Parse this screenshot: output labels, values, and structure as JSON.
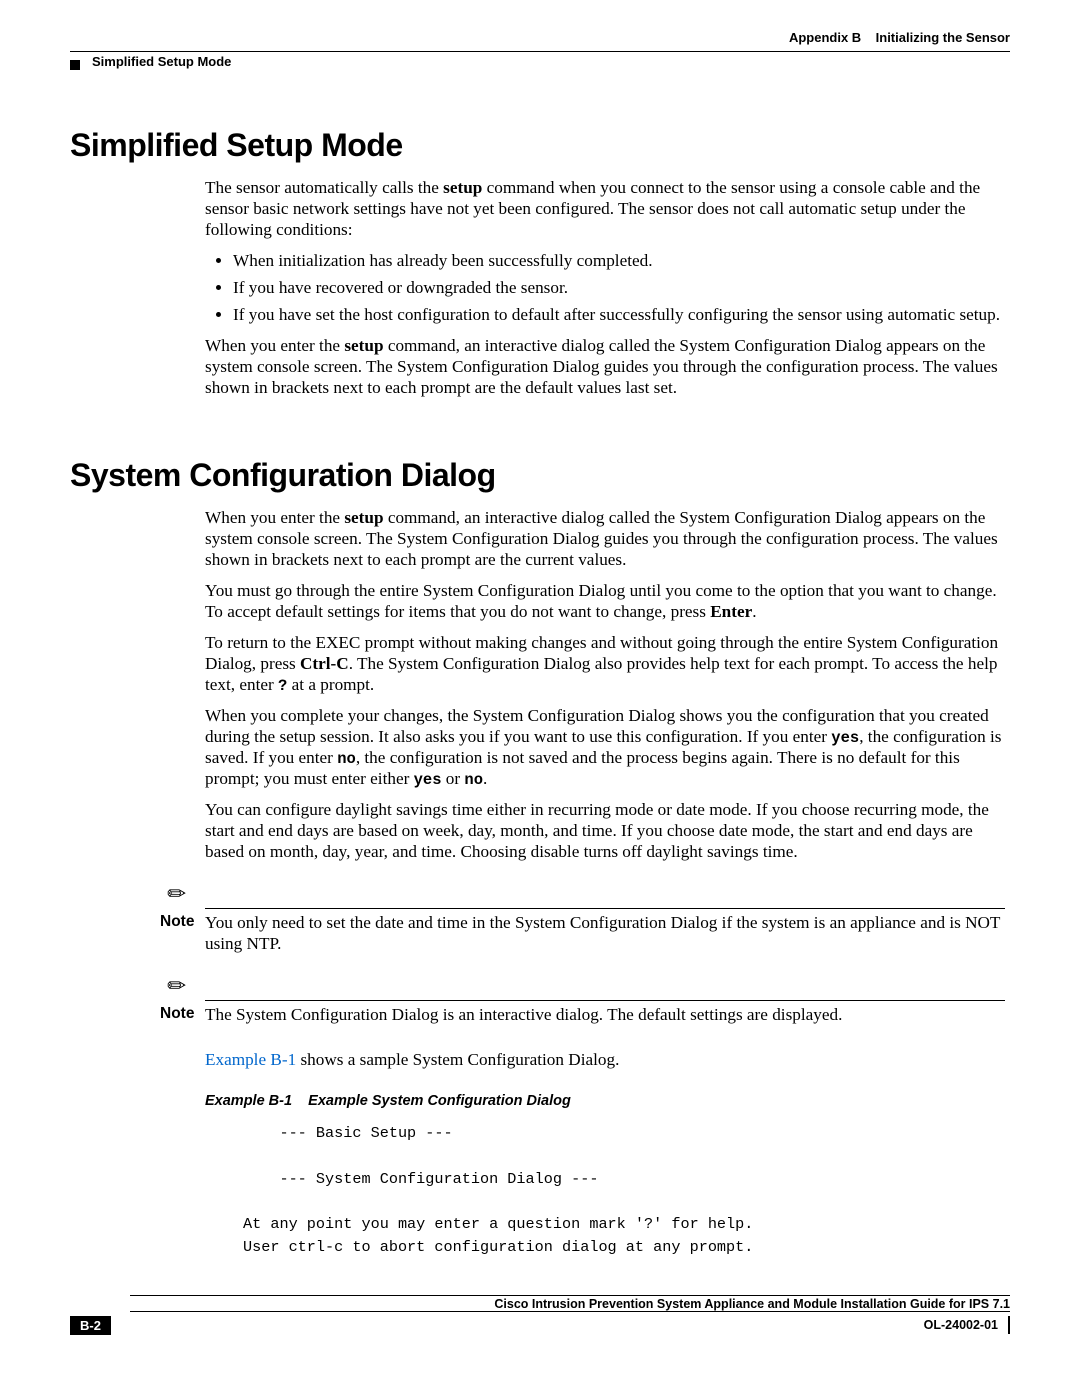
{
  "header": {
    "appendix": "Appendix B",
    "appendix_title": "Initializing the Sensor",
    "running_head": "Simplified Setup Mode"
  },
  "section1": {
    "title": "Simplified Setup Mode",
    "intro_a": "The sensor automatically calls the ",
    "intro_cmd": "setup",
    "intro_b": " command when you connect to the sensor using a console cable and the sensor basic network settings have not yet been configured. The sensor does not call automatic setup under the following conditions:",
    "bullets": [
      "When initialization has already been successfully completed.",
      "If you have recovered or downgraded the sensor.",
      "If you have set the host configuration to default after successfully configuring the sensor using automatic setup."
    ],
    "p2_a": "When you enter the ",
    "p2_cmd": "setup",
    "p2_b": " command, an interactive dialog called the System Configuration Dialog appears on the system console screen. The System Configuration Dialog guides you through the configuration process. The values shown in brackets next to each prompt are the default values last set."
  },
  "section2": {
    "title": "System Configuration Dialog",
    "p1_a": "When you enter the ",
    "p1_cmd": "setup",
    "p1_b": " command, an interactive dialog called the System Configuration Dialog appears on the system console screen. The System Configuration Dialog guides you through the configuration process. The values shown in brackets next to each prompt are the current values.",
    "p2_a": "You must go through the entire System Configuration Dialog until you come to the option that you want to change. To accept default settings for items that you do not want to change, press ",
    "p2_key": "Enter",
    "p2_b": ".",
    "p3_a": "To return to the EXEC prompt without making changes and without going through the entire System Configuration Dialog, press ",
    "p3_key": "Ctrl-C",
    "p3_b": ". The System Configuration Dialog also provides help text for each prompt. To access the help text, enter ",
    "p3_q": "?",
    "p3_c": " at a prompt.",
    "p4_a": "When you complete your changes, the System Configuration Dialog shows you the configuration that you created during the setup session. It also asks you if you want to use this configuration. If you enter ",
    "p4_yes": "yes",
    "p4_b": ", the configuration is saved. If you enter ",
    "p4_no": "no",
    "p4_c": ", the configuration is not saved and the process begins again. There is no default for this prompt; you must enter either ",
    "p4_yes2": "yes",
    "p4_or": " or ",
    "p4_no2": "no",
    "p4_d": ".",
    "p5": "You can configure daylight savings time either in recurring mode or date mode. If you choose recurring mode, the start and end days are based on week, day, month, and time. If you choose date mode, the start and end days are based on month, day, year, and time. Choosing disable turns off daylight savings time."
  },
  "notes": {
    "label": "Note",
    "n1": "You only need to set the date and time in the System Configuration Dialog if the system is an appliance and is NOT using NTP.",
    "n2": "The System Configuration Dialog is an interactive dialog. The default settings are displayed."
  },
  "example": {
    "link": "Example B-1",
    "link_after": " shows a sample System Configuration Dialog.",
    "cap_num": "Example B-1",
    "cap_title": "Example System Configuration Dialog",
    "code": "    --- Basic Setup ---\n\n    --- System Configuration Dialog ---\n\nAt any point you may enter a question mark '?' for help.\nUser ctrl-c to abort configuration dialog at any prompt."
  },
  "footer": {
    "book": "Cisco Intrusion Prevention System Appliance and Module Installation Guide for IPS 7.1",
    "page": "B-2",
    "doc": "OL-24002-01"
  }
}
